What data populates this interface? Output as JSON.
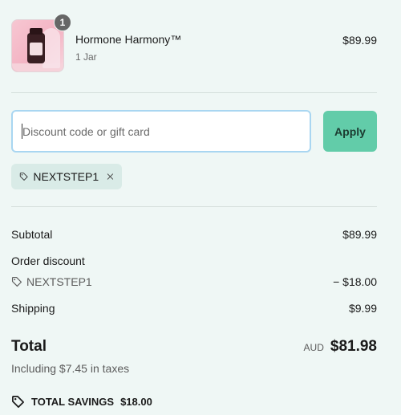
{
  "product": {
    "name": "Hormone Harmony™",
    "variant": "1 Jar",
    "price": "$89.99",
    "quantity": "1"
  },
  "discount": {
    "placeholder": "Discount code or gift card",
    "value": "",
    "apply_label": "Apply",
    "applied_code": "NEXTSTEP1"
  },
  "summary": {
    "subtotal_label": "Subtotal",
    "subtotal_value": "$89.99",
    "order_discount_label": "Order discount",
    "discount_code": "NEXTSTEP1",
    "discount_value": "− $18.00",
    "shipping_label": "Shipping",
    "shipping_value": "$9.99",
    "total_label": "Total",
    "currency": "AUD",
    "total_value": "$81.98",
    "taxes_note": "Including $7.45 in taxes",
    "savings_label": "TOTAL SAVINGS",
    "savings_value": "$18.00"
  },
  "colors": {
    "background": "#eff7f5",
    "apply_button": "#62cca9",
    "input_focus_border": "#a9d6f1",
    "chip": "#d9ebe7"
  }
}
